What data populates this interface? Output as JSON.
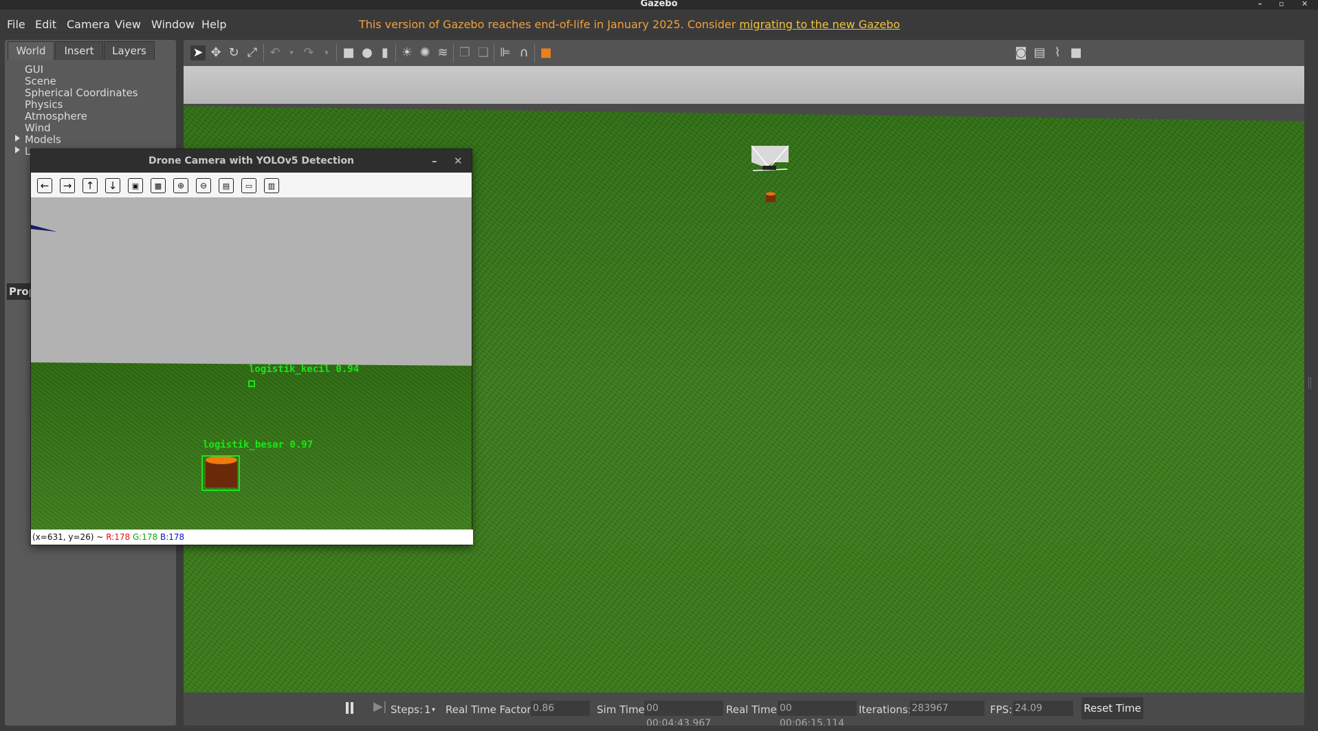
{
  "window": {
    "title": "Gazebo"
  },
  "menubar": {
    "items": [
      "File",
      "Edit",
      "Camera",
      "View",
      "Window",
      "Help"
    ],
    "notice_text": "This version of Gazebo reaches end-of-life in January 2025. Consider ",
    "notice_link": "migrating to the new Gazebo"
  },
  "left_panel": {
    "tabs": [
      "World",
      "Insert",
      "Layers"
    ],
    "tree": [
      "GUI",
      "Scene",
      "Spherical Coordinates",
      "Physics",
      "Atmosphere",
      "Wind",
      "Models",
      "L"
    ],
    "properties_label": "Prop"
  },
  "camera_window": {
    "title": "Drone Camera with YOLOv5 Detection",
    "detections": [
      {
        "label": "logistik_kecil 0.94"
      },
      {
        "label": "logistik_besar 0.97"
      }
    ],
    "status": {
      "coords": "(x=631, y=26) ~",
      "r": "R:178",
      "g": "G:178",
      "b": "B:178"
    }
  },
  "bottom_bar": {
    "steps_label": "Steps:",
    "steps_value": "1",
    "rtf_label": "Real Time Factor:",
    "rtf_value": "0.86",
    "sim_time_label": "Sim Time:",
    "sim_time_value": "00 00:04:43.967",
    "real_time_label": "Real Time:",
    "real_time_value": "00 00:06:15.114",
    "iterations_label": "Iterations:",
    "iterations_value": "283967",
    "fps_label": "FPS:",
    "fps_value": "24.09",
    "reset_label": "Reset Time"
  },
  "colors": {
    "notice": "#f2a03d",
    "detection": "#19e619",
    "grass": "#3c7d1c",
    "sky": "#b2b2b2"
  }
}
